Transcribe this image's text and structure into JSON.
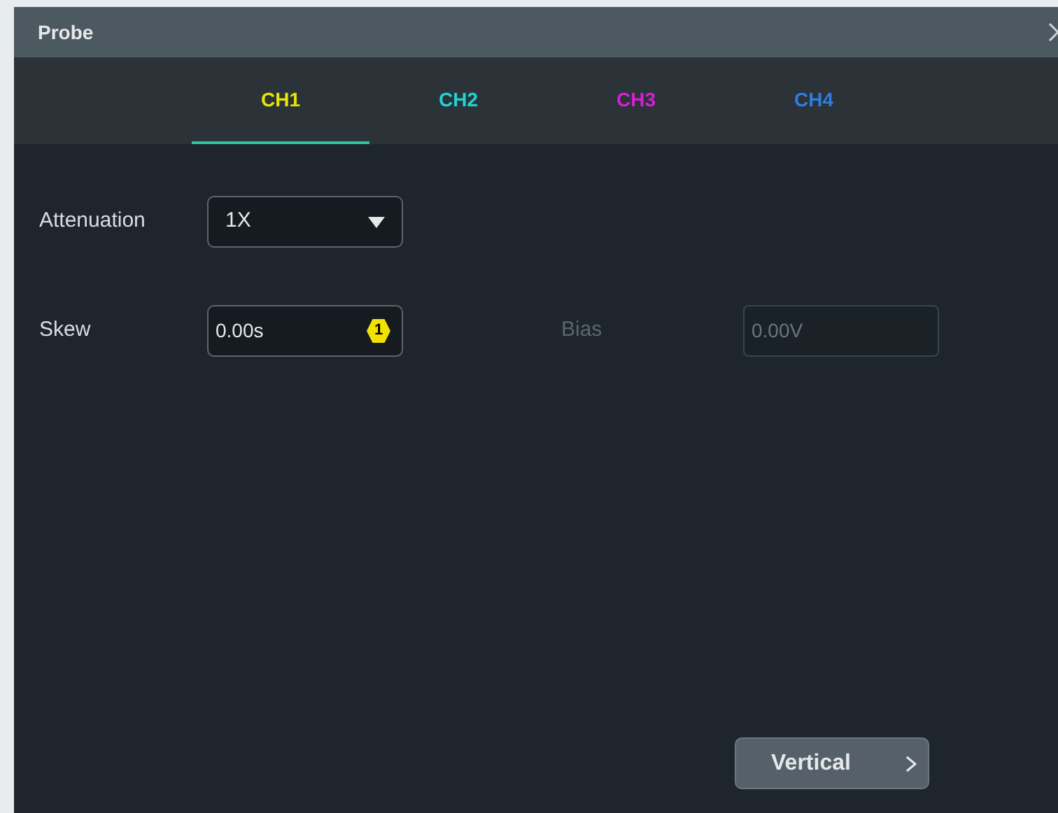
{
  "window": {
    "title": "Probe"
  },
  "tabs": [
    {
      "label": "CH1",
      "selected": true,
      "color": "#e6e600"
    },
    {
      "label": "CH2",
      "selected": false,
      "color": "#22d3d3"
    },
    {
      "label": "CH3",
      "selected": false,
      "color": "#d61fd6"
    },
    {
      "label": "CH4",
      "selected": false,
      "color": "#2f7de1"
    }
  ],
  "attenuation": {
    "label": "Attenuation",
    "value": "1X"
  },
  "skew": {
    "label": "Skew",
    "value": "0.00s",
    "badge": "1"
  },
  "bias": {
    "label": "Bias",
    "value": "0.00V",
    "disabled": true
  },
  "next_button": {
    "label": "Vertical"
  }
}
